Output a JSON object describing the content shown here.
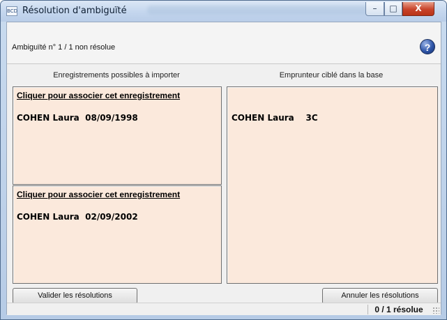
{
  "window": {
    "title": "Résolution d'ambiguïté",
    "app_icon_text": "BCD",
    "minimize_glyph": "–",
    "maximize_glyph": "□",
    "close_glyph": "X"
  },
  "header": {
    "ambiguity_status": "Ambiguïté n° 1 / 1 non résolue",
    "help_glyph": "?"
  },
  "columns": {
    "left_title": "Enregistrements possibles à importer",
    "right_title": "Emprunteur ciblé dans la base"
  },
  "candidates": [
    {
      "link": "Cliquer pour associer cet enregistrement",
      "record": "COHEN Laura  08/09/1998"
    },
    {
      "link": "Cliquer pour associer cet enregistrement",
      "record": "COHEN Laura  02/09/2002"
    }
  ],
  "target": {
    "record": "COHEN Laura    3C"
  },
  "buttons": {
    "validate": "Valider les résolutions",
    "cancel": "Annuler les résolutions"
  },
  "statusbar": {
    "text": "0 / 1 résolue"
  },
  "colors": {
    "panel_background": "#fbe9dc",
    "titlebar": "#c4d6ee",
    "close_button": "#c8432a"
  }
}
